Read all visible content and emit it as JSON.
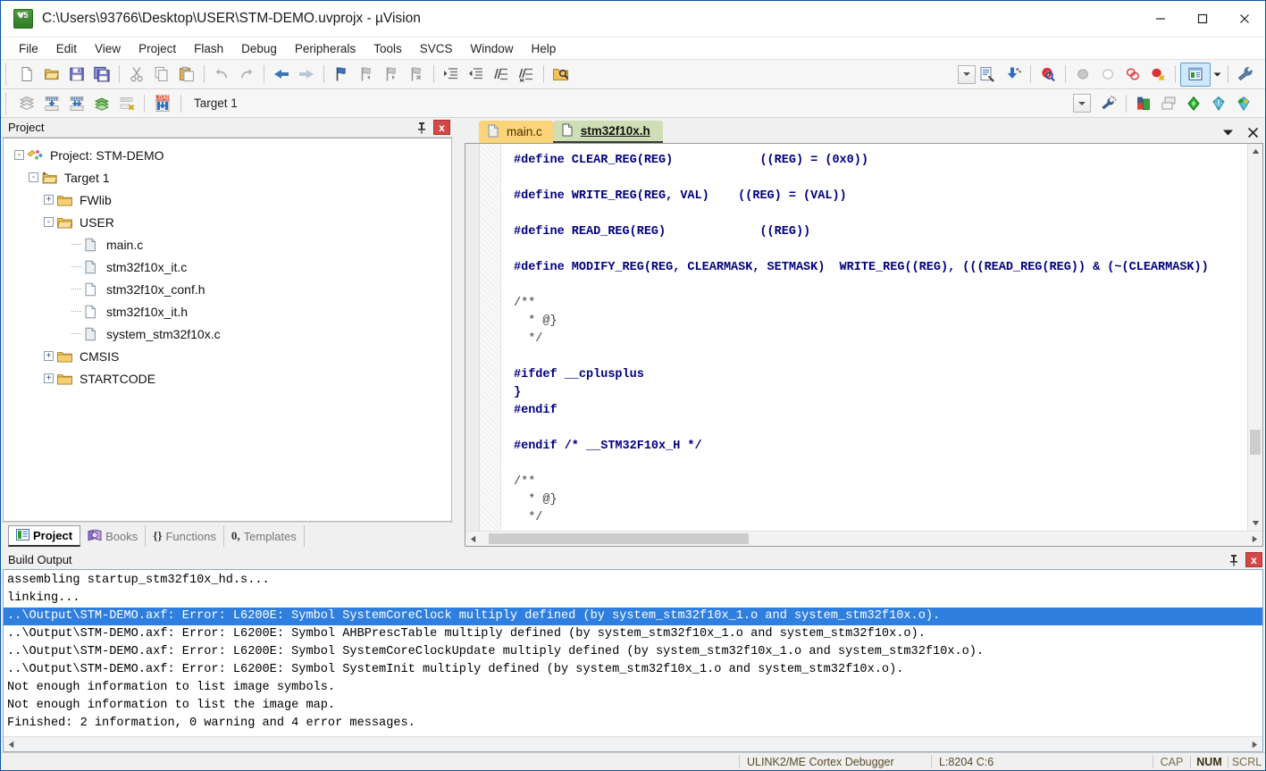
{
  "window": {
    "title": "C:\\Users\\93766\\Desktop\\USER\\STM-DEMO.uvprojx - µVision",
    "minimize_label": "Minimize",
    "maximize_label": "Maximize",
    "close_label": "Close"
  },
  "menubar": {
    "items": [
      {
        "label": "File"
      },
      {
        "label": "Edit"
      },
      {
        "label": "View"
      },
      {
        "label": "Project"
      },
      {
        "label": "Flash"
      },
      {
        "label": "Debug"
      },
      {
        "label": "Peripherals"
      },
      {
        "label": "Tools"
      },
      {
        "label": "SVCS"
      },
      {
        "label": "Window"
      },
      {
        "label": "Help"
      }
    ]
  },
  "toolbar_main": {
    "buttons": [
      {
        "name": "new-file-icon",
        "title": "New"
      },
      {
        "name": "open-file-icon",
        "title": "Open"
      },
      {
        "name": "save-icon",
        "title": "Save"
      },
      {
        "name": "save-all-icon",
        "title": "Save All"
      },
      {
        "name": "cut-icon",
        "title": "Cut"
      },
      {
        "name": "copy-icon",
        "title": "Copy"
      },
      {
        "name": "paste-icon",
        "title": "Paste"
      },
      {
        "name": "undo-icon",
        "title": "Undo"
      },
      {
        "name": "redo-icon",
        "title": "Redo"
      },
      {
        "name": "navigate-back-icon",
        "title": "Back"
      },
      {
        "name": "navigate-forward-icon",
        "title": "Forward"
      },
      {
        "name": "bookmark-toggle-icon",
        "title": "Insert/Remove Bookmark"
      },
      {
        "name": "bookmark-prev-icon",
        "title": "Previous Bookmark"
      },
      {
        "name": "bookmark-next-icon",
        "title": "Next Bookmark"
      },
      {
        "name": "bookmark-clear-icon",
        "title": "Clear All Bookmarks"
      },
      {
        "name": "indent-icon",
        "title": "Indent"
      },
      {
        "name": "outdent-icon",
        "title": "Outdent"
      },
      {
        "name": "comment-icon",
        "title": "Comment"
      },
      {
        "name": "uncomment-icon",
        "title": "Uncomment"
      },
      {
        "name": "find-in-files-icon",
        "title": "Find in Files"
      }
    ],
    "right_buttons": [
      {
        "name": "config-wizard-icon",
        "title": "Configuration Wizard"
      },
      {
        "name": "download-icon",
        "title": "Download"
      },
      {
        "name": "debug-start-icon",
        "title": "Start/Stop Debug Session"
      },
      {
        "name": "breakpoint-insert-icon",
        "title": "Insert/Remove Breakpoint"
      },
      {
        "name": "breakpoint-enable-icon",
        "title": "Enable/Disable Breakpoint"
      },
      {
        "name": "breakpoint-disable-all-icon",
        "title": "Disable All Breakpoints"
      },
      {
        "name": "breakpoint-kill-all-icon",
        "title": "Kill All Breakpoints"
      },
      {
        "name": "window-layout-icon",
        "title": "Manage Window Layout"
      },
      {
        "name": "configure-icon",
        "title": "Configure"
      }
    ]
  },
  "toolbar_build": {
    "buttons": [
      {
        "name": "translate-file-icon",
        "title": "Translate Current File"
      },
      {
        "name": "build-icon",
        "title": "Build"
      },
      {
        "name": "rebuild-icon",
        "title": "Rebuild All"
      },
      {
        "name": "batch-build-icon",
        "title": "Batch Build"
      },
      {
        "name": "stop-build-icon",
        "title": "Stop Build"
      },
      {
        "name": "load-icon",
        "title": "Download to Flash"
      }
    ],
    "target_value": "Target 1",
    "target_options": [
      "Target 1"
    ],
    "right_buttons": [
      {
        "name": "target-options-icon",
        "title": "Options for Target"
      },
      {
        "name": "manage-project-items-icon",
        "title": "Manage Project Items"
      },
      {
        "name": "run-to-main-icon",
        "title": "Manage Run-Time Environment"
      },
      {
        "name": "pack-installer-icon",
        "title": "Pack Installer"
      },
      {
        "name": "select-software-packs-icon",
        "title": "Select Software Packs"
      },
      {
        "name": "manage-rte-icon",
        "title": "Manage Run-Time Environment"
      }
    ]
  },
  "project_panel": {
    "title": "Project",
    "pin_label": "Auto Hide",
    "close_label": "x",
    "tree": [
      {
        "label": "Project: STM-DEMO",
        "depth": 0,
        "expander": "-",
        "icon": "project-icon"
      },
      {
        "label": "Target 1",
        "depth": 1,
        "expander": "-",
        "icon": "target-icon"
      },
      {
        "label": "FWlib",
        "depth": 2,
        "expander": "+",
        "icon": "folder-closed-icon"
      },
      {
        "label": "USER",
        "depth": 2,
        "expander": "-",
        "icon": "folder-open-icon"
      },
      {
        "label": "main.c",
        "depth": 3,
        "expander": "",
        "icon": "c-file-icon"
      },
      {
        "label": "stm32f10x_it.c",
        "depth": 3,
        "expander": "",
        "icon": "c-file-icon"
      },
      {
        "label": "stm32f10x_conf.h",
        "depth": 3,
        "expander": "",
        "icon": "h-file-icon"
      },
      {
        "label": "stm32f10x_it.h",
        "depth": 3,
        "expander": "",
        "icon": "h-file-icon"
      },
      {
        "label": "system_stm32f10x.c",
        "depth": 3,
        "expander": "",
        "icon": "c-file-icon"
      },
      {
        "label": "CMSIS",
        "depth": 2,
        "expander": "+",
        "icon": "folder-closed-icon"
      },
      {
        "label": "STARTCODE",
        "depth": 2,
        "expander": "+",
        "icon": "folder-closed-icon"
      }
    ],
    "tabs": [
      {
        "label": "Project",
        "icon": "project-tab-icon",
        "selected": true
      },
      {
        "label": "Books",
        "icon": "books-tab-icon",
        "selected": false
      },
      {
        "label": "Functions",
        "icon": "functions-tab-icon",
        "selected": false
      },
      {
        "label": "Templates",
        "icon": "templates-tab-icon",
        "selected": false
      }
    ]
  },
  "editor": {
    "tabs": [
      {
        "label": "main.c",
        "active": false,
        "icon": "c-file-icon"
      },
      {
        "label": "stm32f10x.h",
        "active": true,
        "icon": "h-file-icon"
      }
    ],
    "tab_menu_label": "Window List",
    "tab_close_label": "Close",
    "lines": [
      {
        "text": "#define CLEAR_REG(REG)            ((REG) = (0x0))",
        "kind": "code"
      },
      {
        "text": "",
        "kind": "blank"
      },
      {
        "text": "#define WRITE_REG(REG, VAL)    ((REG) = (VAL))",
        "kind": "code"
      },
      {
        "text": "",
        "kind": "blank"
      },
      {
        "text": "#define READ_REG(REG)             ((REG))",
        "kind": "code"
      },
      {
        "text": "",
        "kind": "blank"
      },
      {
        "text": "#define MODIFY_REG(REG, CLEARMASK, SETMASK)  WRITE_REG((REG), (((READ_REG(REG)) & (~(CLEARMASK))",
        "kind": "code"
      },
      {
        "text": "",
        "kind": "blank"
      },
      {
        "text": "/**",
        "kind": "comment"
      },
      {
        "text": "  * @}",
        "kind": "comment"
      },
      {
        "text": "  */",
        "kind": "comment"
      },
      {
        "text": "",
        "kind": "blank"
      },
      {
        "text": "#ifdef __cplusplus",
        "kind": "code"
      },
      {
        "text": "}",
        "kind": "code"
      },
      {
        "text": "#endif",
        "kind": "code"
      },
      {
        "text": "",
        "kind": "blank"
      },
      {
        "text": "#endif /* __STM32F10x_H */",
        "kind": "code"
      },
      {
        "text": "",
        "kind": "blank"
      },
      {
        "text": "/**",
        "kind": "comment"
      },
      {
        "text": "  * @}",
        "kind": "comment"
      },
      {
        "text": "  */",
        "kind": "comment"
      },
      {
        "text": "",
        "kind": "blank"
      },
      {
        "text": "  /**",
        "kind": "comment"
      }
    ]
  },
  "build_output": {
    "title": "Build Output",
    "pin_label": "Auto Hide",
    "close_label": "x",
    "lines": [
      {
        "text": "assembling startup_stm32f10x_hd.s...",
        "selected": false
      },
      {
        "text": "linking...",
        "selected": false
      },
      {
        "text": "..\\Output\\STM-DEMO.axf: Error: L6200E: Symbol SystemCoreClock multiply defined (by system_stm32f10x_1.o and system_stm32f10x.o).",
        "selected": true
      },
      {
        "text": "..\\Output\\STM-DEMO.axf: Error: L6200E: Symbol AHBPrescTable multiply defined (by system_stm32f10x_1.o and system_stm32f10x.o).",
        "selected": false
      },
      {
        "text": "..\\Output\\STM-DEMO.axf: Error: L6200E: Symbol SystemCoreClockUpdate multiply defined (by system_stm32f10x_1.o and system_stm32f10x.o).",
        "selected": false
      },
      {
        "text": "..\\Output\\STM-DEMO.axf: Error: L6200E: Symbol SystemInit multiply defined (by system_stm32f10x_1.o and system_stm32f10x.o).",
        "selected": false
      },
      {
        "text": "Not enough information to list image symbols.",
        "selected": false
      },
      {
        "text": "Not enough information to list the image map.",
        "selected": false
      },
      {
        "text": "Finished: 2 information, 0 warning and 4 error messages.",
        "selected": false
      }
    ]
  },
  "statusbar": {
    "debugger": "ULINK2/ME Cortex Debugger",
    "position": "L:8204 C:6",
    "flags": [
      {
        "label": "CAP",
        "on": false
      },
      {
        "label": "NUM",
        "on": true
      },
      {
        "label": "SCRL",
        "on": false
      }
    ]
  },
  "colors": {
    "titlebar_border": "#0a57a4",
    "selection_blue": "#2f7fe0",
    "tab_active": "#cfdfb5",
    "tab_inactive": "#fbd378",
    "code_keyword": "#000080",
    "close_red": "#d04a4a"
  }
}
